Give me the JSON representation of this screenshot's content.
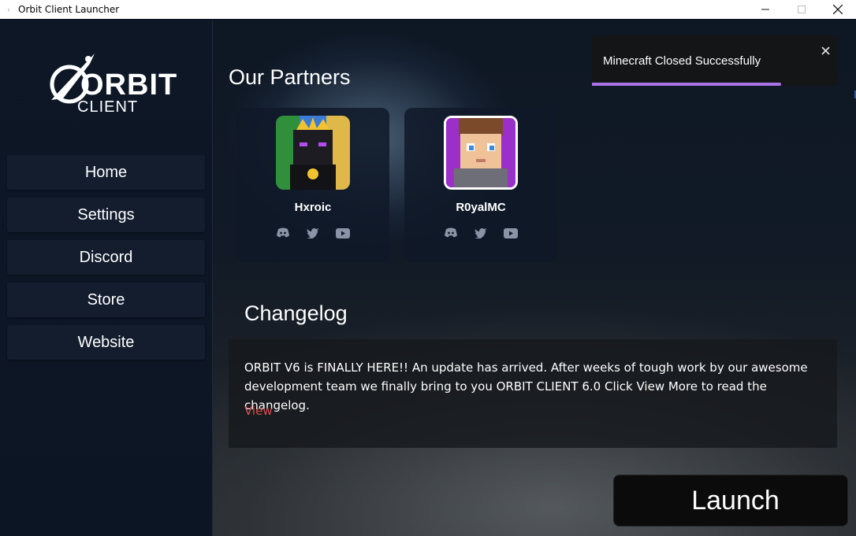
{
  "window": {
    "title": "Orbit Client Launcher"
  },
  "logo": {
    "main": "ORBIT",
    "sub": "CLIENT"
  },
  "sidebar": {
    "items": [
      {
        "label": "Home"
      },
      {
        "label": "Settings"
      },
      {
        "label": "Discord"
      },
      {
        "label": "Store"
      },
      {
        "label": "Website"
      }
    ]
  },
  "partners": {
    "title": "Our Partners",
    "items": [
      {
        "name": "Hxroic",
        "socials": [
          "discord-icon",
          "twitter-icon",
          "youtube-icon"
        ]
      },
      {
        "name": "R0yalMC",
        "socials": [
          "discord-icon",
          "twitter-icon",
          "youtube-icon"
        ]
      }
    ]
  },
  "changelog": {
    "title": "Changelog",
    "text": "ORBIT V6 is FINALLY HERE!! An update has arrived. After weeks of tough work by our awesome development team we finally bring to you ORBIT CLIENT 6.0 Click View More to read the changelog.",
    "link": "View"
  },
  "toast": {
    "message": "Minecraft Closed Successfully",
    "progress": 0.77,
    "accent": "#a972e6"
  },
  "launch": {
    "label": "Launch"
  },
  "colors": {
    "sidebar_bg": "#0d1726",
    "nav_item_bg": "#131d2e",
    "link": "#e04a4a"
  }
}
